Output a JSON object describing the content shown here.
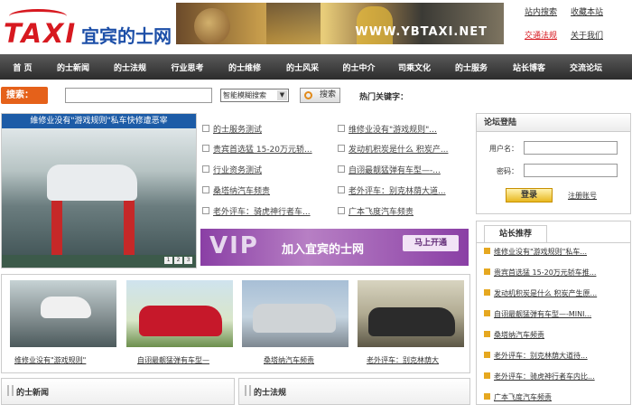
{
  "header": {
    "logo_taxi": "TAXI",
    "logo_cn": "宜宾的士网",
    "banner_url": "WWW.YBTAXI.NET",
    "links": [
      "站内搜索",
      "收藏本站",
      "交通法规",
      "关于我们"
    ]
  },
  "nav": [
    "首 页",
    "的士新闻",
    "的士法规",
    "行业思考",
    "的士维修",
    "的士风采",
    "的士中介",
    "司乘文化",
    "的士服务",
    "站长博客",
    "交流论坛"
  ],
  "search": {
    "label": "搜索：",
    "input_value": "",
    "select_value": "智能模糊搜索",
    "button": "搜索",
    "hot_label": "热门关键字："
  },
  "slide": {
    "caption": "維修业没有\"游戏规则\"私车快修遭恶宰",
    "pager": [
      "1",
      "2",
      "3"
    ]
  },
  "news": [
    "的士服务测试",
    "维修业没有\"游戏规则\"...",
    "贵宾首选猛 15-20万元轿...",
    "发动机积炭是什么 积炭产...",
    "行业资务测试",
    "自诩最靓猛弹有车型—-...",
    "桑塔纳汽车频责",
    "老外评车：别克林荫大道...",
    "老外评车：骑虎神行者车...",
    "广本飞度汽车频责"
  ],
  "vip": {
    "big": "VIP",
    "text": "加入宜宾的士网",
    "button": "马上开通"
  },
  "login": {
    "title": "论坛登陆",
    "user_label": "用户名：",
    "pass_label": "密码：",
    "button": "登录",
    "register": "注册账号"
  },
  "recommend": {
    "title": "站长推荐",
    "items": [
      "维修业没有\"游戏规则\"私车...",
      "贵宾首选猛 15-20万元轿车推...",
      "发动机积炭是什么 积炭产生原...",
      "自诩最靓猛弹有车型—-MINI...",
      "桑塔纳汽车频责",
      "老外评车：别克林荫大道待...",
      "老外评车：骑虎神行者车内比...",
      "广本飞度汽车频责"
    ]
  },
  "thumbs": [
    "维修业没有\"游戏规则\"",
    "自诩最靓猛弹有车型—",
    "桑塔纳汽车频责",
    "老外评车：别克林荫大"
  ],
  "sections": [
    "的士新闻",
    "的士法规"
  ],
  "colors": {
    "brand_red": "#d71920",
    "brand_blue": "#1d4fa8",
    "nav_dark": "#2c2c2c",
    "search_orange": "#e5611a",
    "vip_purple": "#8a3fa5"
  }
}
